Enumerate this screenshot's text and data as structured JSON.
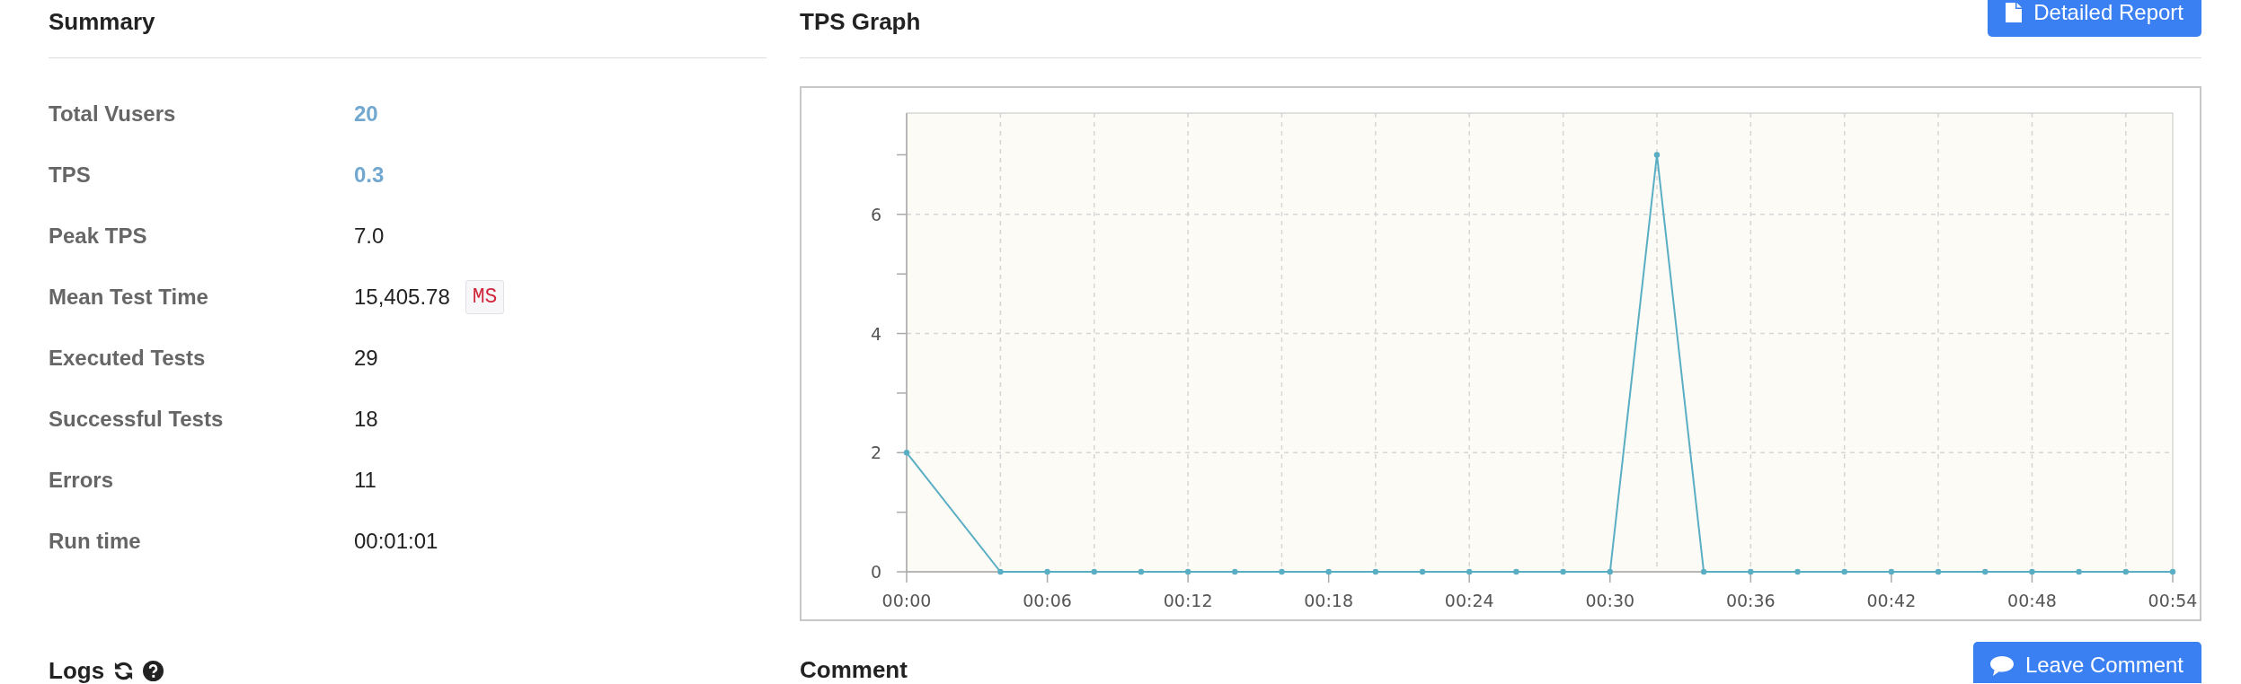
{
  "summary": {
    "title": "Summary",
    "rows": [
      {
        "label": "Total Vusers",
        "value": "20",
        "kind": "accent"
      },
      {
        "label": "TPS",
        "value": "0.3",
        "kind": "accent"
      },
      {
        "label": "Peak TPS",
        "value": "7.0",
        "kind": "plain"
      },
      {
        "label": "Mean Test Time",
        "value": "15,405.78",
        "unit": "MS",
        "kind": "plain"
      },
      {
        "label": "Executed Tests",
        "value": "29",
        "kind": "plain"
      },
      {
        "label": "Successful Tests",
        "value": "18",
        "kind": "plain"
      },
      {
        "label": "Errors",
        "value": "11",
        "kind": "plain"
      },
      {
        "label": "Run time",
        "value": "00:01:01",
        "kind": "plain"
      }
    ]
  },
  "tps_graph": {
    "title": "TPS Graph",
    "report_button": "Detailed Report",
    "chart_data": {
      "type": "line",
      "grid": true,
      "x": [
        0,
        4,
        6,
        8,
        10,
        12,
        14,
        16,
        18,
        20,
        22,
        24,
        26,
        28,
        30,
        32,
        34,
        36,
        38,
        40,
        42,
        44,
        46,
        48,
        50,
        52,
        54
      ],
      "series": [
        {
          "color": "#5aaec3",
          "marker": "circle",
          "values": [
            2,
            0,
            0,
            0,
            0,
            0,
            0,
            0,
            0,
            0,
            0,
            0,
            0,
            0,
            0,
            7,
            0,
            0,
            0,
            0,
            0,
            0,
            0,
            0,
            0,
            0,
            0
          ]
        }
      ],
      "xlim": [
        0,
        54
      ],
      "ylim": [
        0,
        7.7
      ],
      "xticks": [
        {
          "value": 0,
          "label": "00:00"
        },
        {
          "value": 6,
          "label": "00:06"
        },
        {
          "value": 12,
          "label": "00:12"
        },
        {
          "value": 18,
          "label": "00:18"
        },
        {
          "value": 24,
          "label": "00:24"
        },
        {
          "value": 30,
          "label": "00:30"
        },
        {
          "value": 36,
          "label": "00:36"
        },
        {
          "value": 42,
          "label": "00:42"
        },
        {
          "value": 48,
          "label": "00:48"
        },
        {
          "value": 54,
          "label": "00:54"
        }
      ],
      "yticks": [
        0,
        2,
        4,
        6
      ]
    }
  },
  "logs": {
    "title": "Logs"
  },
  "comment": {
    "title": "Comment",
    "button": "Leave Comment"
  }
}
